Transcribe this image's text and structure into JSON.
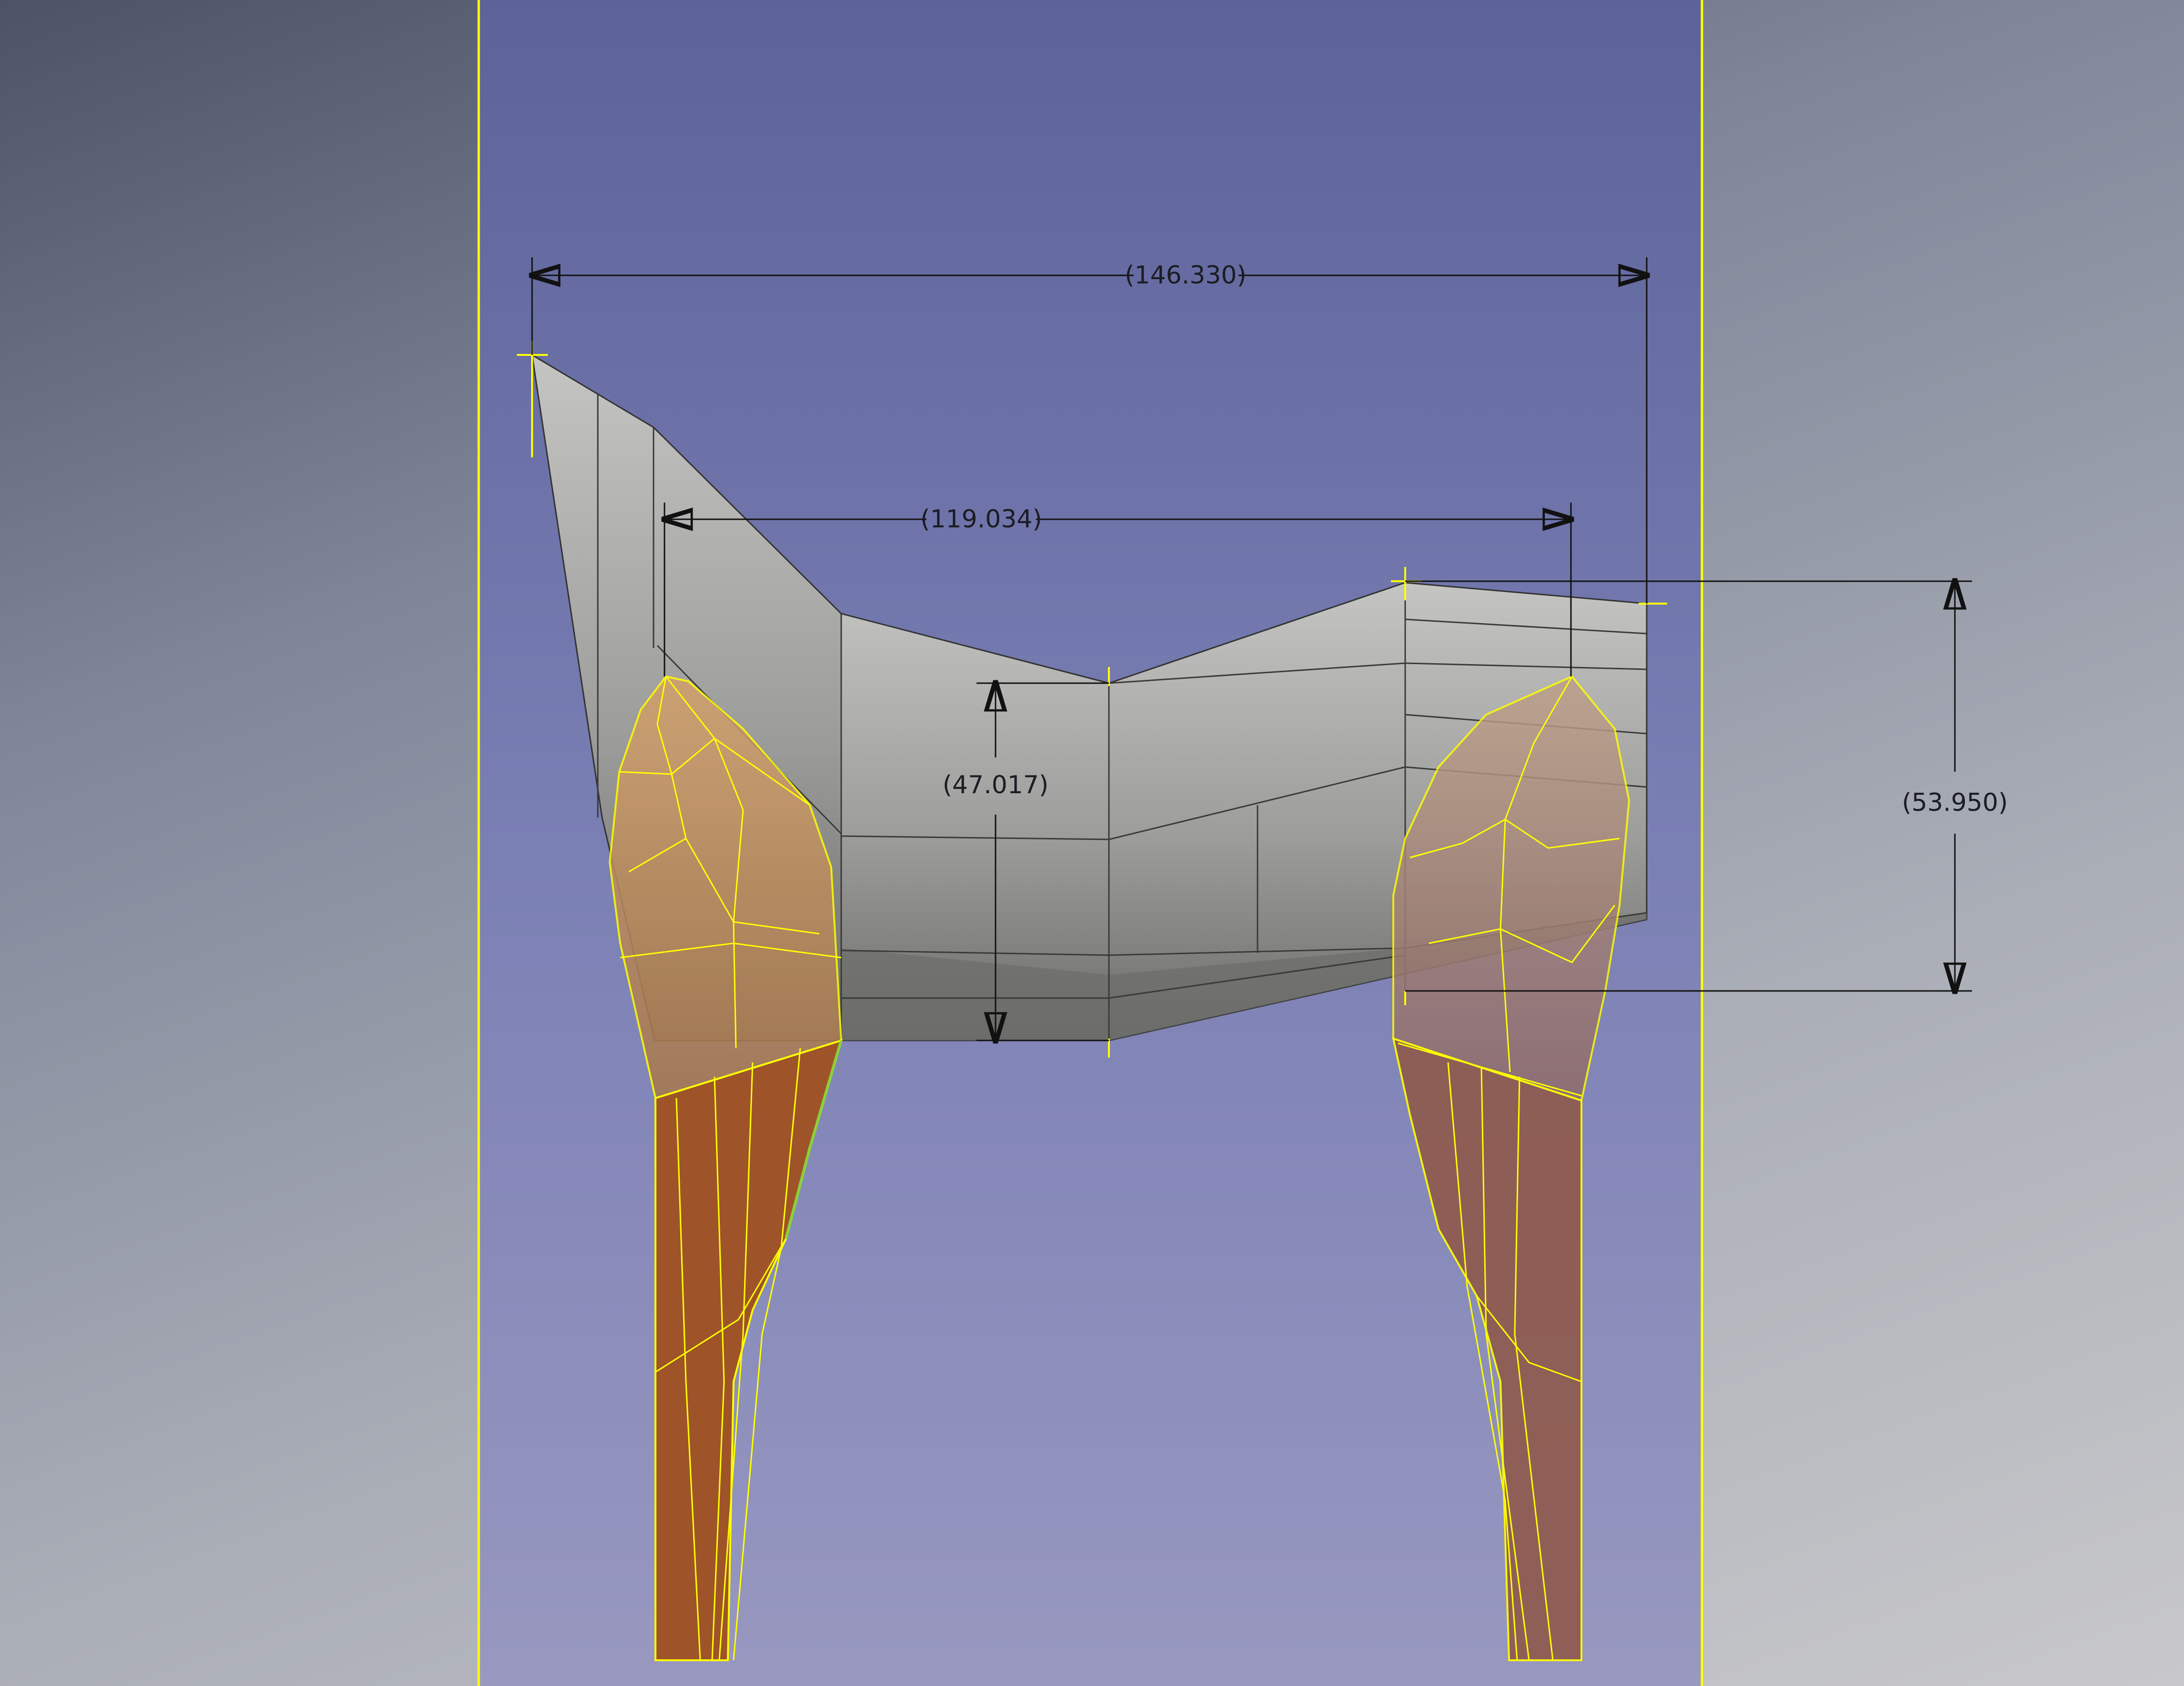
{
  "viewport": {
    "background_colors": {
      "outer_top": "#4d5366",
      "outer_bottom": "#c8c8cb",
      "sketch_panel_top": "#5c6399",
      "sketch_panel_bottom": "#9898c0"
    },
    "highlight_color": "#ffff00",
    "body_color": "#b0b0ae",
    "tooth_crown_color": "#c8945c",
    "tooth_root_color": "#9e5428"
  },
  "dimensions": {
    "overall_width": "(146.330)",
    "inner_width": "(119.034)",
    "center_height": "(47.017)",
    "right_height": "(53.950)"
  }
}
